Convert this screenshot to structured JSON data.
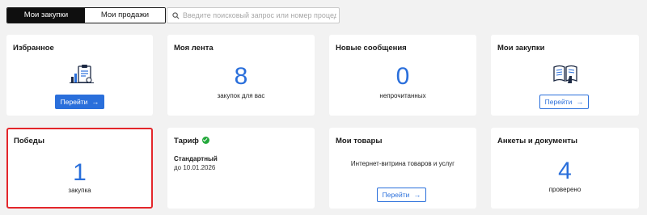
{
  "tabs": [
    {
      "label": "Мои закупки",
      "active": true
    },
    {
      "label": "Мои продажи",
      "active": false
    }
  ],
  "search": {
    "placeholder": "Введите поисковый запрос или номер процедуры"
  },
  "cards": {
    "favorites": {
      "title": "Избранное",
      "button": "Перейти",
      "icon": "clipboard-chart-icon"
    },
    "feed": {
      "title": "Моя лента",
      "count": "8",
      "caption": "закупок для вас"
    },
    "messages": {
      "title": "Новые сообщения",
      "count": "0",
      "caption": "непрочитанных"
    },
    "my_purchases": {
      "title": "Мои закупки",
      "button": "Перейти",
      "icon": "open-book-icon"
    },
    "wins": {
      "title": "Победы",
      "count": "1",
      "caption": "закупка"
    },
    "tariff": {
      "title": "Тариф",
      "plan": "Стандартный",
      "valid_until": "до 10.01.2026",
      "status_color": "#22a83a"
    },
    "goods": {
      "title": "Мои товары",
      "caption": "Интернет-витрина товаров и услуг",
      "button": "Перейти"
    },
    "forms": {
      "title": "Анкеты и документы",
      "count": "4",
      "caption": "проверено"
    }
  },
  "colors": {
    "accent": "#2a6fdb",
    "highlight": "#e3262b",
    "success": "#22a83a"
  },
  "arrow": "→"
}
